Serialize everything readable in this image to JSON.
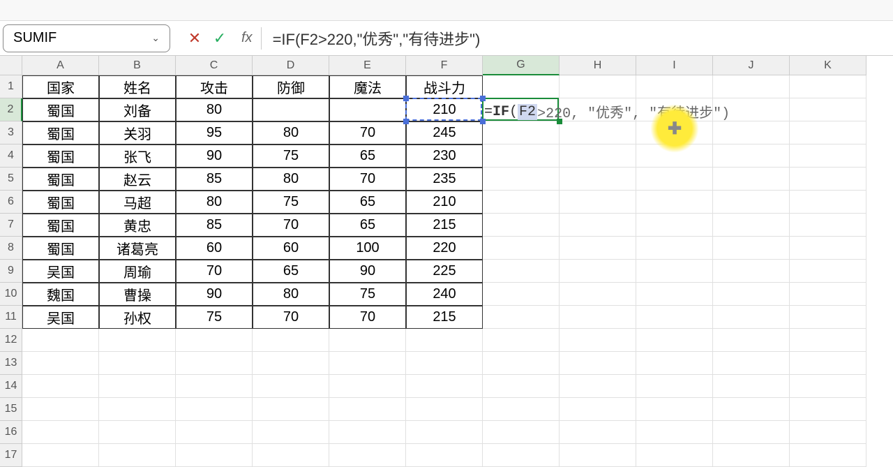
{
  "name_box": "SUMIF",
  "formula_bar": "=IF(F2>220,\"优秀\",\"有待进步\")",
  "columns": [
    "A",
    "B",
    "C",
    "D",
    "E",
    "F",
    "G",
    "H",
    "I",
    "J",
    "K"
  ],
  "row_count": 17,
  "active_col": "G",
  "active_row": 2,
  "headers": {
    "A": "国家",
    "B": "姓名",
    "C": "攻击",
    "D": "防御",
    "E": "魔法",
    "F": "战斗力"
  },
  "rows": [
    {
      "A": "蜀国",
      "B": "刘备",
      "C": "80",
      "D": "",
      "E": "",
      "F": "210"
    },
    {
      "A": "蜀国",
      "B": "关羽",
      "C": "95",
      "D": "80",
      "E": "70",
      "F": "245"
    },
    {
      "A": "蜀国",
      "B": "张飞",
      "C": "90",
      "D": "75",
      "E": "65",
      "F": "230"
    },
    {
      "A": "蜀国",
      "B": "赵云",
      "C": "85",
      "D": "80",
      "E": "70",
      "F": "235"
    },
    {
      "A": "蜀国",
      "B": "马超",
      "C": "80",
      "D": "75",
      "E": "65",
      "F": "210"
    },
    {
      "A": "蜀国",
      "B": "黄忠",
      "C": "85",
      "D": "70",
      "E": "65",
      "F": "215"
    },
    {
      "A": "蜀国",
      "B": "诸葛亮",
      "C": "60",
      "D": "60",
      "E": "100",
      "F": "220"
    },
    {
      "A": "吴国",
      "B": "周瑜",
      "C": "70",
      "D": "65",
      "E": "90",
      "F": "225"
    },
    {
      "A": "魏国",
      "B": "曹操",
      "C": "90",
      "D": "80",
      "E": "75",
      "F": "240"
    },
    {
      "A": "吴国",
      "B": "孙权",
      "C": "75",
      "D": "70",
      "E": "70",
      "F": "215"
    }
  ],
  "inline_formula": {
    "eq": "=",
    "fn": "IF",
    "open": "(",
    "ref": "F2",
    "rest": ">220, \"优秀\", \"有待进步\")"
  },
  "icons": {
    "cancel": "✕",
    "confirm": "✓",
    "fx": "fx",
    "chevron": "⌄",
    "plus": "✚"
  }
}
